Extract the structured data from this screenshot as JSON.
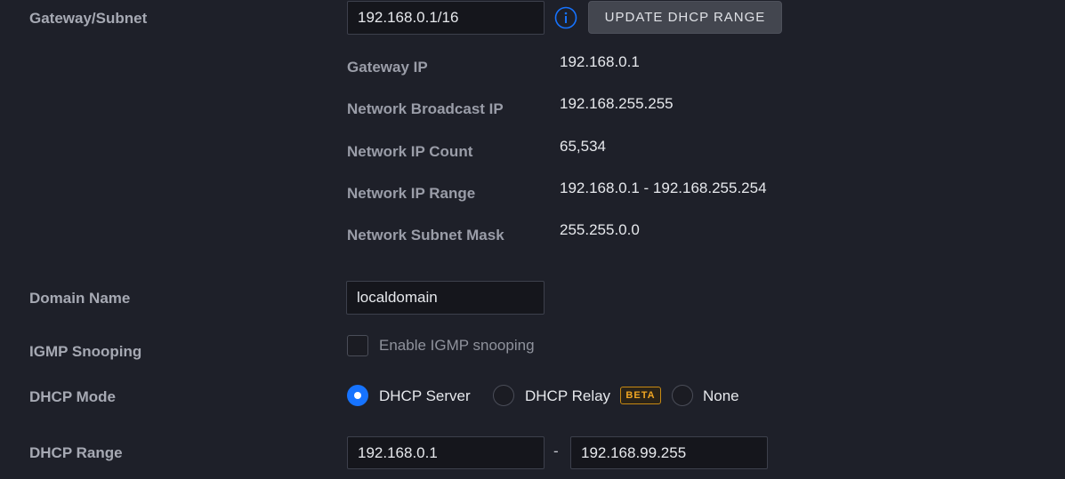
{
  "gateway_subnet": {
    "label": "Gateway/Subnet",
    "value": "192.168.0.1/16",
    "info_icon": "info-icon",
    "update_button": "UPDATE DHCP RANGE",
    "details": [
      {
        "label": "Gateway IP",
        "value": "192.168.0.1"
      },
      {
        "label": "Network Broadcast IP",
        "value": "192.168.255.255"
      },
      {
        "label": "Network IP Count",
        "value": "65,534"
      },
      {
        "label": "Network IP Range",
        "value": "192.168.0.1 - 192.168.255.254"
      },
      {
        "label": "Network Subnet Mask",
        "value": "255.255.0.0"
      }
    ]
  },
  "domain_name": {
    "label": "Domain Name",
    "value": "localdomain"
  },
  "igmp": {
    "label": "IGMP Snooping",
    "checkbox_label": "Enable IGMP snooping",
    "checked": false
  },
  "dhcp_mode": {
    "label": "DHCP Mode",
    "options": [
      {
        "label": "DHCP Server",
        "selected": true
      },
      {
        "label": "DHCP Relay",
        "selected": false,
        "badge": "BETA"
      },
      {
        "label": "None",
        "selected": false
      }
    ]
  },
  "dhcp_range": {
    "label": "DHCP Range",
    "start": "192.168.0.1",
    "separator": "-",
    "end": "192.168.99.255"
  },
  "colors": {
    "background": "#1e2029",
    "accent": "#1673ff",
    "beta": "#f0a623"
  }
}
